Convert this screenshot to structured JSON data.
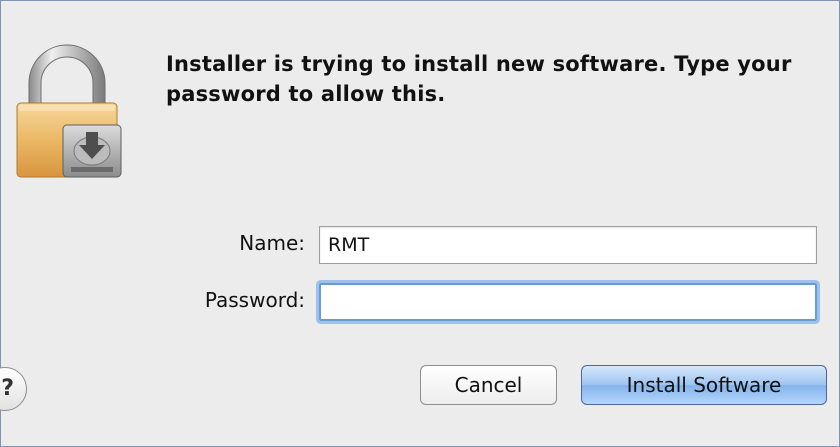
{
  "dialog": {
    "message": "Installer is trying to install new software. Type your password to allow this.",
    "fields": {
      "name_label": "Name:",
      "name_value": "RMT",
      "password_label": "Password:",
      "password_value": ""
    },
    "buttons": {
      "help_label": "?",
      "cancel_label": "Cancel",
      "install_label": "Install Software"
    },
    "icons": {
      "lock": "lock-installer-icon"
    },
    "colors": {
      "default_button": "#9dc4f1",
      "focus_ring": "#6a9ad4",
      "background": "#ececec"
    }
  }
}
